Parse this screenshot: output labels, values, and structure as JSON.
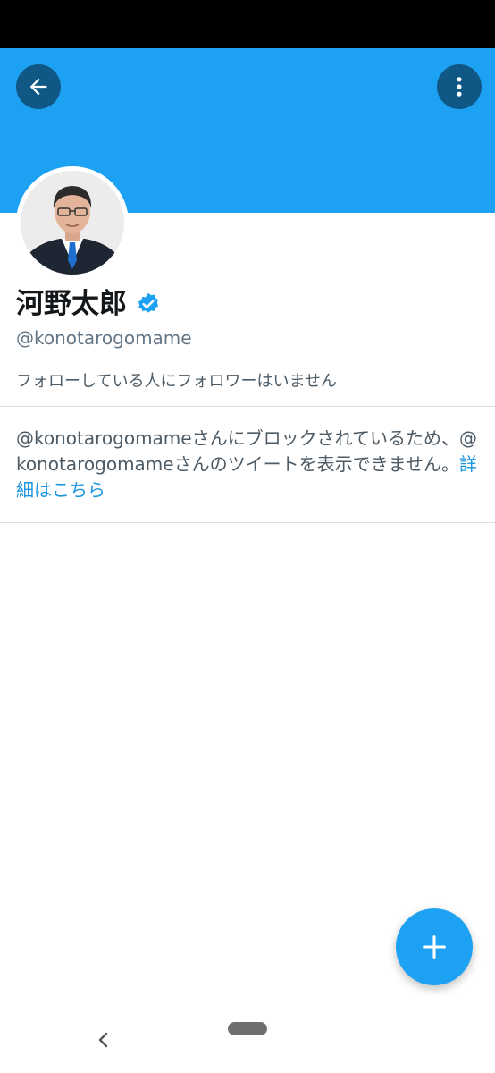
{
  "profile": {
    "name": "河野太郎",
    "handle": "@konotarogomame",
    "verified": true,
    "follow_note": "フォローしている人にフォロワーはいません"
  },
  "blocked": {
    "message": "@konotarogomameさんにブロックされているため、@konotarogomameさんのツイートを表示できません。",
    "link_label": "詳細はこちら"
  },
  "icons": {
    "back": "arrow-left-icon",
    "more": "more-vertical-icon",
    "verified": "verified-badge-icon",
    "compose": "plus-icon",
    "nav_back": "chevron-left-icon",
    "home": "home-pill-icon"
  },
  "colors": {
    "brand": "#1da1f2",
    "link": "#1b95e0",
    "text_primary": "#14171a",
    "text_secondary": "#657786",
    "divider": "#dcdfe2"
  }
}
